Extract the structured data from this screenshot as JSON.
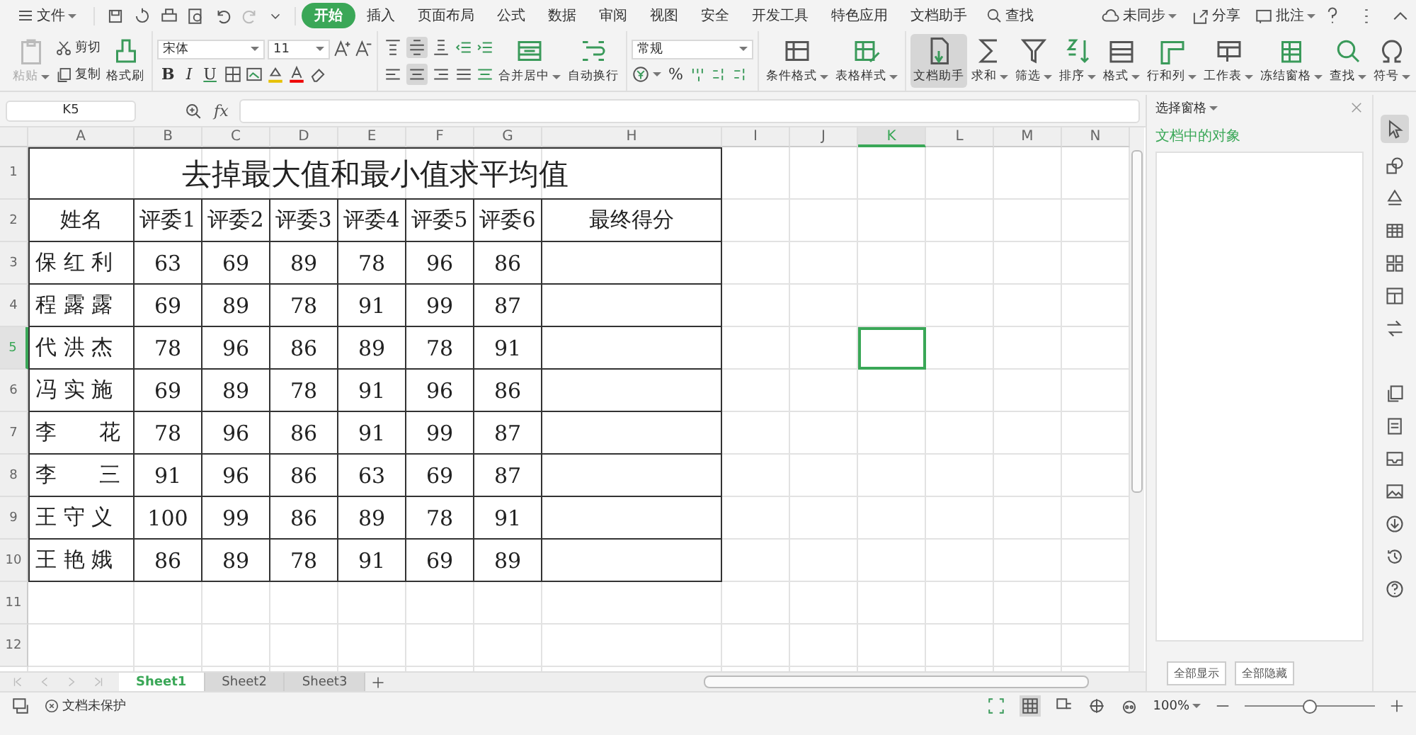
{
  "menu": {
    "file_label": "文件",
    "tabs": [
      {
        "label": "开始",
        "selected": true
      },
      {
        "label": "插入",
        "selected": false
      },
      {
        "label": "页面布局",
        "selected": false
      },
      {
        "label": "公式",
        "selected": false
      },
      {
        "label": "数据",
        "selected": false
      },
      {
        "label": "审阅",
        "selected": false
      },
      {
        "label": "视图",
        "selected": false
      },
      {
        "label": "安全",
        "selected": false
      },
      {
        "label": "开发工具",
        "selected": false
      },
      {
        "label": "特色应用",
        "selected": false
      },
      {
        "label": "文档助手",
        "selected": false
      }
    ],
    "search": "查找",
    "sync": "未同步",
    "share": "分享",
    "comment": "批注"
  },
  "clipboard": {
    "paste": {
      "label": "粘贴",
      "disabled": true
    },
    "cut": "剪切",
    "copy": "复制",
    "format_painter": "格式刷"
  },
  "font": {
    "name": "宋体",
    "size": "11",
    "styles": [
      "B",
      "I",
      "U"
    ]
  },
  "alignment": {
    "vertical": [
      {
        "selected": false
      },
      {
        "selected": true
      },
      {
        "selected": false
      }
    ],
    "horizontal": [
      {
        "selected": false
      },
      {
        "selected": true
      },
      {
        "selected": false
      }
    ],
    "merge": "合并居中",
    "wrap": "自动换行"
  },
  "number": {
    "format": "常规",
    "percent": "%"
  },
  "tools": [
    {
      "label": "条件格式",
      "dropdown": true,
      "selected": false
    },
    {
      "label": "表格样式",
      "dropdown": true,
      "selected": false
    },
    {
      "label": "文档助手",
      "dropdown": false,
      "selected": true
    },
    {
      "label": "求和",
      "dropdown": true,
      "selected": false
    },
    {
      "label": "筛选",
      "dropdown": true,
      "selected": false
    },
    {
      "label": "排序",
      "dropdown": true,
      "selected": false
    },
    {
      "label": "格式",
      "dropdown": true,
      "selected": false
    },
    {
      "label": "行和列",
      "dropdown": true,
      "selected": false
    },
    {
      "label": "工作表",
      "dropdown": true,
      "selected": false
    },
    {
      "label": "冻结窗格",
      "dropdown": true,
      "selected": false
    },
    {
      "label": "查找",
      "dropdown": true,
      "selected": false
    },
    {
      "label": "符号",
      "dropdown": true,
      "selected": false
    }
  ],
  "formula_bar": {
    "name_box": "K5",
    "fx": "fx"
  },
  "columns": [
    {
      "label": "A",
      "selected": false
    },
    {
      "label": "B",
      "selected": false
    },
    {
      "label": "C",
      "selected": false
    },
    {
      "label": "D",
      "selected": false
    },
    {
      "label": "E",
      "selected": false
    },
    {
      "label": "F",
      "selected": false
    },
    {
      "label": "G",
      "selected": false
    },
    {
      "label": "H",
      "selected": false
    },
    {
      "label": "I",
      "selected": false
    },
    {
      "label": "J",
      "selected": false
    },
    {
      "label": "K",
      "selected": true
    },
    {
      "label": "L",
      "selected": false
    },
    {
      "label": "M",
      "selected": false
    },
    {
      "label": "N",
      "selected": false
    }
  ],
  "row_headers": [
    {
      "label": "1",
      "selected": false
    },
    {
      "label": "2",
      "selected": false
    },
    {
      "label": "3",
      "selected": false
    },
    {
      "label": "4",
      "selected": false
    },
    {
      "label": "5",
      "selected": true
    },
    {
      "label": "6",
      "selected": false
    },
    {
      "label": "7",
      "selected": false
    },
    {
      "label": "8",
      "selected": false
    },
    {
      "label": "9",
      "selected": false
    },
    {
      "label": "10",
      "selected": false
    },
    {
      "label": "11",
      "selected": false
    },
    {
      "label": "12",
      "selected": false
    }
  ],
  "sheet": {
    "title": "去掉最大值和最小值求平均值",
    "rows": [
      [
        "姓名",
        "评委1",
        "评委2",
        "评委3",
        "评委4",
        "评委5",
        "评委6",
        "最终得分"
      ],
      [
        "保 红 利",
        "63",
        "69",
        "89",
        "78",
        "96",
        "86"
      ],
      [
        "程 露 露",
        "69",
        "89",
        "78",
        "91",
        "99",
        "87"
      ],
      [
        "代 洪 杰",
        "78",
        "96",
        "86",
        "89",
        "78",
        "91"
      ],
      [
        "冯 实 施",
        "69",
        "89",
        "78",
        "91",
        "96",
        "86"
      ],
      [
        "李　　花",
        "78",
        "96",
        "86",
        "91",
        "99",
        "87"
      ],
      [
        "李　　三",
        "91",
        "96",
        "86",
        "63",
        "69",
        "87"
      ],
      [
        "王 守 义",
        "100",
        "99",
        "86",
        "89",
        "78",
        "91"
      ],
      [
        "王 艳 娥",
        "86",
        "89",
        "78",
        "91",
        "69",
        "89"
      ]
    ]
  },
  "sheet_tabs": [
    {
      "label": "Sheet1",
      "selected": true
    },
    {
      "label": "Sheet2",
      "selected": false
    },
    {
      "label": "Sheet3",
      "selected": false
    }
  ],
  "side_panel": {
    "title": "选择窗格",
    "heading": "文档中的对象",
    "buttons": [
      "全部显示",
      "全部隐藏"
    ]
  },
  "status_bar": {
    "protection": "文档未保护",
    "zoom": "100%",
    "zoom_slider": {
      "level": 0.5
    }
  }
}
